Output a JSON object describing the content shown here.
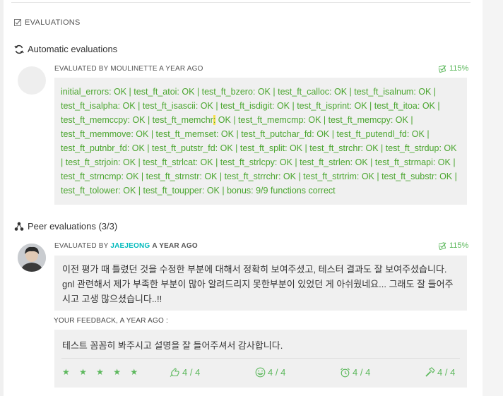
{
  "section": {
    "title": "EVALUATIONS",
    "icon": "checkbox-icon"
  },
  "automatic": {
    "heading": "Automatic evaluations",
    "icon": "refresh-icon",
    "evaluated_by": "EVALUATED BY MOULINETTE A YEAR AGO",
    "score": "115%",
    "log_before": "initial_errors: OK | test_ft_atoi: OK | test_ft_bzero: OK | test_ft_calloc: OK | test_ft_isalnum: OK | test_ft_isalpha: OK | test_ft_isascii: OK | test_ft_isdigit: OK | test_ft_isprint: OK | test_ft_itoa: OK | test_ft_memccpy: OK | test_ft_memchr",
    "log_highlight": ":",
    "log_after": " OK | test_ft_memcmp: OK | test_ft_memcpy: OK | test_ft_memmove: OK | test_ft_memset: OK | test_ft_putchar_fd: OK | test_ft_putendl_fd: OK | test_ft_putnbr_fd: OK | test_ft_putstr_fd: OK | test_ft_split: OK | test_ft_strchr: OK | test_ft_strdup: OK | test_ft_strjoin: OK | test_ft_strlcat: OK | test_ft_strlcpy: OK | test_ft_strlen: OK | test_ft_strmapi: OK | test_ft_strncmp: OK | test_ft_strnstr: OK | test_ft_strrchr: OK | test_ft_strtrim: OK | test_ft_substr: OK | test_ft_tolower: OK | test_ft_toupper: OK | bonus: 9/9 functions correct"
  },
  "peer": {
    "heading": "Peer evaluations (3/3)",
    "icon": "peers-icon",
    "evaluated_by_prefix": "EVALUATED BY",
    "evaluator": "JAEJEONG",
    "ago": "A YEAR AGO",
    "score": "115%",
    "comment": "이전 평가 때 틀렸던 것을 수정한 부분에 대해서 정확히 보여주셨고, 테스터 결과도 잘 보여주셨습니다. gnl 관련해서 제가 부족한 부분이 많아 알려드리지 못한부분이 있었던 게 아쉬웠네요... 그래도 잘 들어주시고 고생 많으셨습니다..!!",
    "feedback_label": "YOUR FEEDBACK, A YEAR AGO :",
    "feedback": "테스트 꼼꼼히 봐주시고 설명을 잘 들어주셔서 감사합니다.",
    "stars": "★ ★ ★ ★ ★",
    "ratings": [
      {
        "icon": "nice-icon",
        "value": "4 / 4"
      },
      {
        "icon": "smile-icon",
        "value": "4 / 4"
      },
      {
        "icon": "alarm-clock-icon",
        "value": "4 / 4"
      },
      {
        "icon": "hammer-icon",
        "value": "4 / 4"
      }
    ]
  },
  "colors": {
    "accent": "#5cb85c",
    "link": "#00babc",
    "box": "#f0f0f0"
  }
}
